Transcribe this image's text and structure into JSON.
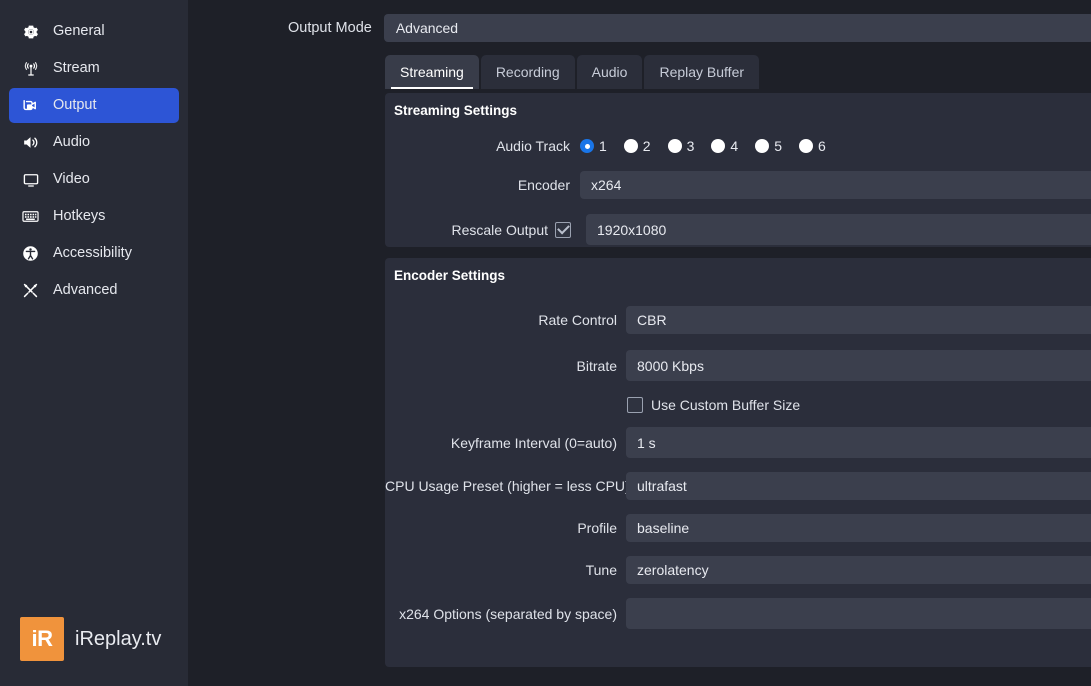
{
  "sidebar": {
    "items": [
      {
        "label": "General",
        "icon": "gear-icon",
        "selected": false
      },
      {
        "label": "Stream",
        "icon": "broadcast-icon",
        "selected": false
      },
      {
        "label": "Output",
        "icon": "camera-icon",
        "selected": true
      },
      {
        "label": "Audio",
        "icon": "speaker-icon",
        "selected": false
      },
      {
        "label": "Video",
        "icon": "monitor-icon",
        "selected": false
      },
      {
        "label": "Hotkeys",
        "icon": "keyboard-icon",
        "selected": false
      },
      {
        "label": "Accessibility",
        "icon": "accessibility-icon",
        "selected": false
      },
      {
        "label": "Advanced",
        "icon": "tools-icon",
        "selected": false
      }
    ],
    "logo": {
      "mark": "iR",
      "text": "iReplay.tv",
      "color": "#f0933c"
    }
  },
  "output_mode": {
    "label": "Output Mode",
    "value": "Advanced"
  },
  "tabs": [
    {
      "label": "Streaming",
      "active": true
    },
    {
      "label": "Recording",
      "active": false
    },
    {
      "label": "Audio",
      "active": false
    },
    {
      "label": "Replay Buffer",
      "active": false
    }
  ],
  "streaming_settings": {
    "title": "Streaming Settings",
    "audio_track": {
      "label": "Audio Track",
      "options": [
        "1",
        "2",
        "3",
        "4",
        "5",
        "6"
      ],
      "selected": "1"
    },
    "encoder": {
      "label": "Encoder",
      "value": "x264"
    },
    "rescale_output": {
      "label": "Rescale Output",
      "checked": true,
      "value": "1920x1080"
    }
  },
  "encoder_settings": {
    "title": "Encoder Settings",
    "rate_control": {
      "label": "Rate Control",
      "value": "CBR"
    },
    "bitrate": {
      "label": "Bitrate",
      "value": "8000 Kbps"
    },
    "custom_buffer": {
      "label": "Use Custom Buffer Size",
      "checked": false
    },
    "keyframe_interval": {
      "label": "Keyframe Interval (0=auto)",
      "value": "1 s"
    },
    "cpu_preset": {
      "label": "CPU Usage Preset (higher = less CPU)",
      "value": "ultrafast"
    },
    "profile": {
      "label": "Profile",
      "value": "baseline"
    },
    "tune": {
      "label": "Tune",
      "value": "zerolatency"
    },
    "x264_options": {
      "label": "x264 Options (separated by space)",
      "value": ""
    }
  },
  "colors": {
    "accent_blue": "#2d55d6",
    "radio_blue": "#1975e8",
    "panel": "#2b2e3b",
    "field": "#3b3f4d",
    "page": "#1e2028",
    "sidebar": "#282b36",
    "logo_orange": "#f0933c"
  }
}
